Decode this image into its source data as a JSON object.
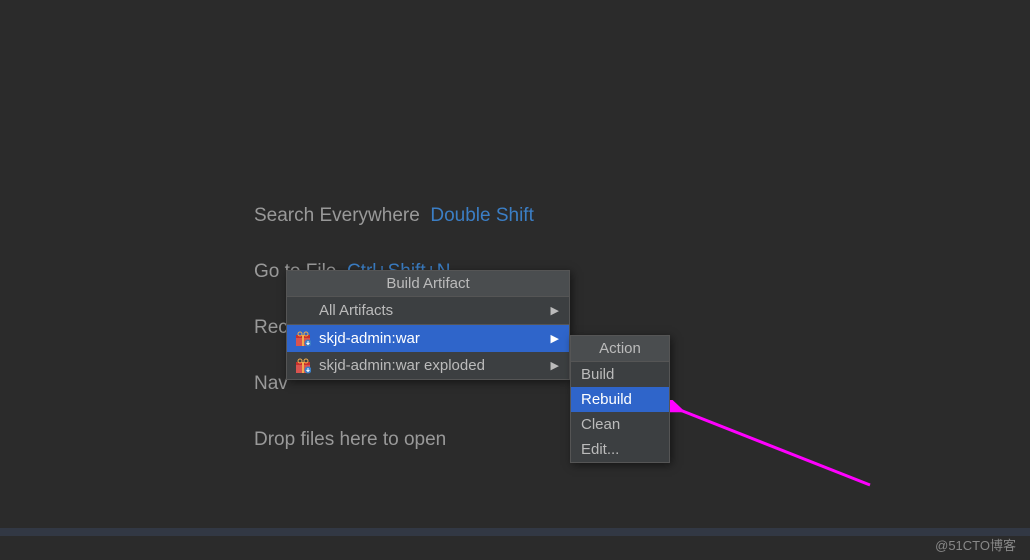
{
  "welcome": {
    "line1_label": "Search Everywhere",
    "line1_shortcut": "Double Shift",
    "line2_label": "Go to File",
    "line2_shortcut": "Ctrl+Shift+N",
    "line3_label": "Rec",
    "line4_label": "Nav",
    "line5_label": "Drop files here to open"
  },
  "popup1": {
    "title": "Build Artifact",
    "items": [
      {
        "label": "All Artifacts",
        "has_icon": false,
        "highlighted": false
      },
      {
        "label": "skjd-admin:war",
        "has_icon": true,
        "highlighted": true
      },
      {
        "label": "skjd-admin:war exploded",
        "has_icon": true,
        "highlighted": false
      }
    ]
  },
  "popup2": {
    "title": "Action",
    "items": [
      {
        "label": "Build",
        "highlighted": false
      },
      {
        "label": "Rebuild",
        "highlighted": true
      },
      {
        "label": "Clean",
        "highlighted": false
      },
      {
        "label": "Edit...",
        "highlighted": false
      }
    ]
  },
  "watermark": "@51CTO博客"
}
